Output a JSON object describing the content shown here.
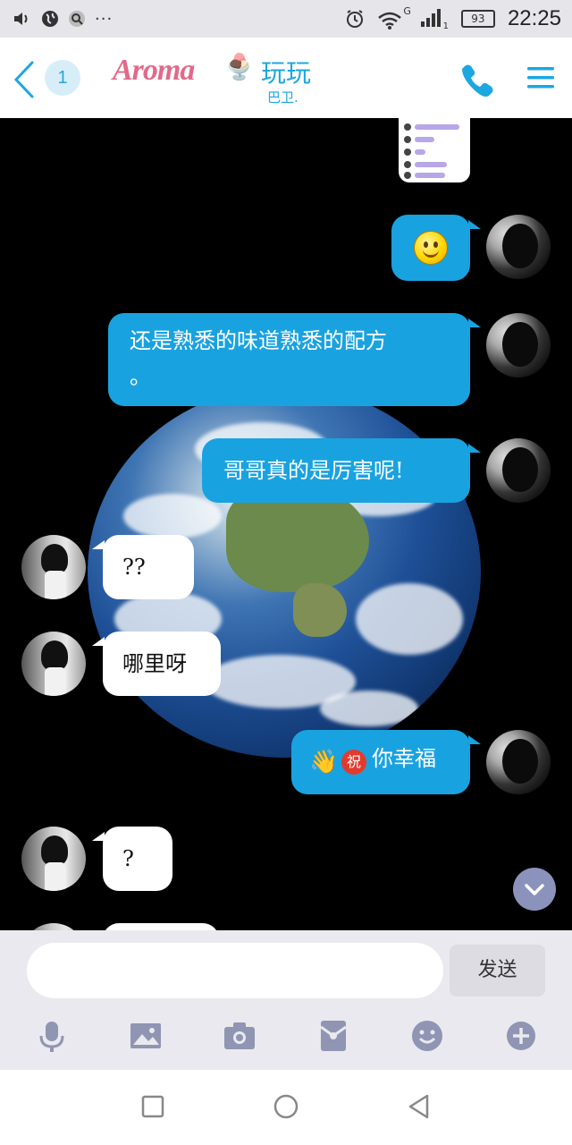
{
  "status_bar": {
    "icons_left": [
      "volume-icon",
      "globe-icon",
      "search-icon",
      "more-icon"
    ],
    "more": "···",
    "icons_right": [
      "alarm-icon",
      "wifi-icon",
      "signal-icon",
      "battery-icon"
    ],
    "network": "G",
    "sim": "1",
    "battery": "93",
    "time": "22:25"
  },
  "header": {
    "unread_count": "1",
    "logo": "Aroma",
    "title": "玩玩",
    "subtitle": "巴卫.",
    "colors": {
      "accent": "#1ca7e0",
      "logo": "#e06a8a"
    }
  },
  "messages": [
    {
      "from": "me",
      "type": "image"
    },
    {
      "from": "me",
      "type": "emoji",
      "emoji": "smiley-icon"
    },
    {
      "from": "me",
      "type": "text",
      "lines": [
        "还是熟悉的味道熟悉的配方",
        "。"
      ]
    },
    {
      "from": "me",
      "type": "text",
      "text": "哥哥真的是厉害呢!"
    },
    {
      "from": "other",
      "type": "text",
      "text": "??"
    },
    {
      "from": "other",
      "type": "text",
      "text": "哪里呀"
    },
    {
      "from": "me",
      "type": "text",
      "emoji": [
        "waving-hand-icon",
        "congratulations-icon"
      ],
      "congrats_char": "祝",
      "text": "你幸福"
    },
    {
      "from": "other",
      "type": "text",
      "text": "?"
    }
  ],
  "input": {
    "placeholder": "",
    "send_label": "发送"
  },
  "toolbar": [
    "microphone-icon",
    "image-icon",
    "camera-icon",
    "red-packet-icon",
    "emoji-icon",
    "plus-icon"
  ],
  "colors": {
    "bubble_me": "#19a2e0",
    "bubble_other": "#ffffff",
    "chat_bg": "#000000"
  }
}
